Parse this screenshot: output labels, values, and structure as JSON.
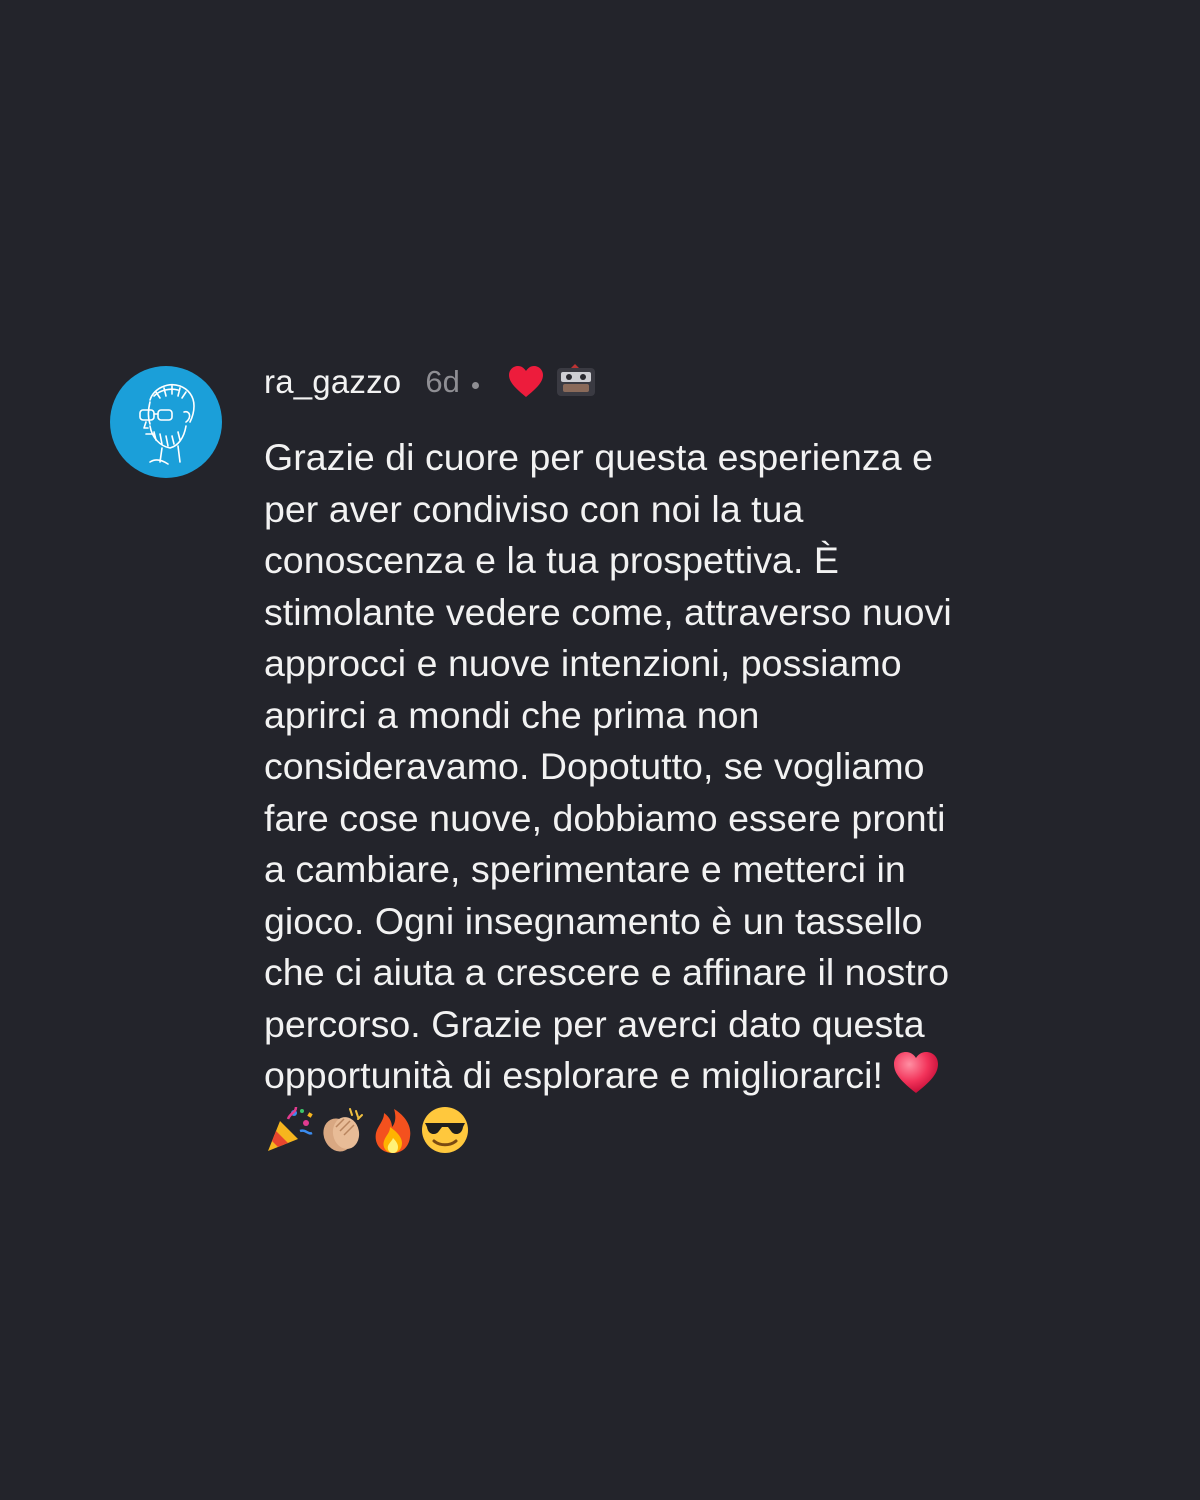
{
  "comment": {
    "username": "ra_gazzo",
    "time_ago": "6d",
    "text": "Grazie di cuore per questa esperienza e\nper aver condiviso con noi la tua\nconoscenza e la tua prospettiva. È\nstimolante vedere come, attraverso nuovi\napprocci e nuove intenzioni, possiamo\naprirci a mondi che prima non\nconsideravamo. Dopotutto, se vogliamo\nfare cose nuove, dobbiamo essere pronti\na cambiare, sperimentare e metterci in\ngioco. Ogni insegnamento è un tassello\nche ci aiuta a crescere e affinare il nostro\npercorso. Grazie per averci dato questa\nopportunità di esplorare e migliorarci!",
    "trailing_emojis": [
      "heart-emoji",
      "party-popper-emoji",
      "clapping-hands-emoji",
      "fire-emoji",
      "sunglasses-face-emoji"
    ],
    "liked_by_author": true,
    "icons": {
      "avatar": "bearded-man-avatar",
      "like": "red-heart-icon",
      "liker": "author-mini-avatar"
    }
  },
  "colors": {
    "background": "#23242b",
    "text": "#f2f2f2",
    "muted": "#8e8e93",
    "avatar_bg": "#1b9fd9",
    "like_red": "#ed1c3c"
  }
}
